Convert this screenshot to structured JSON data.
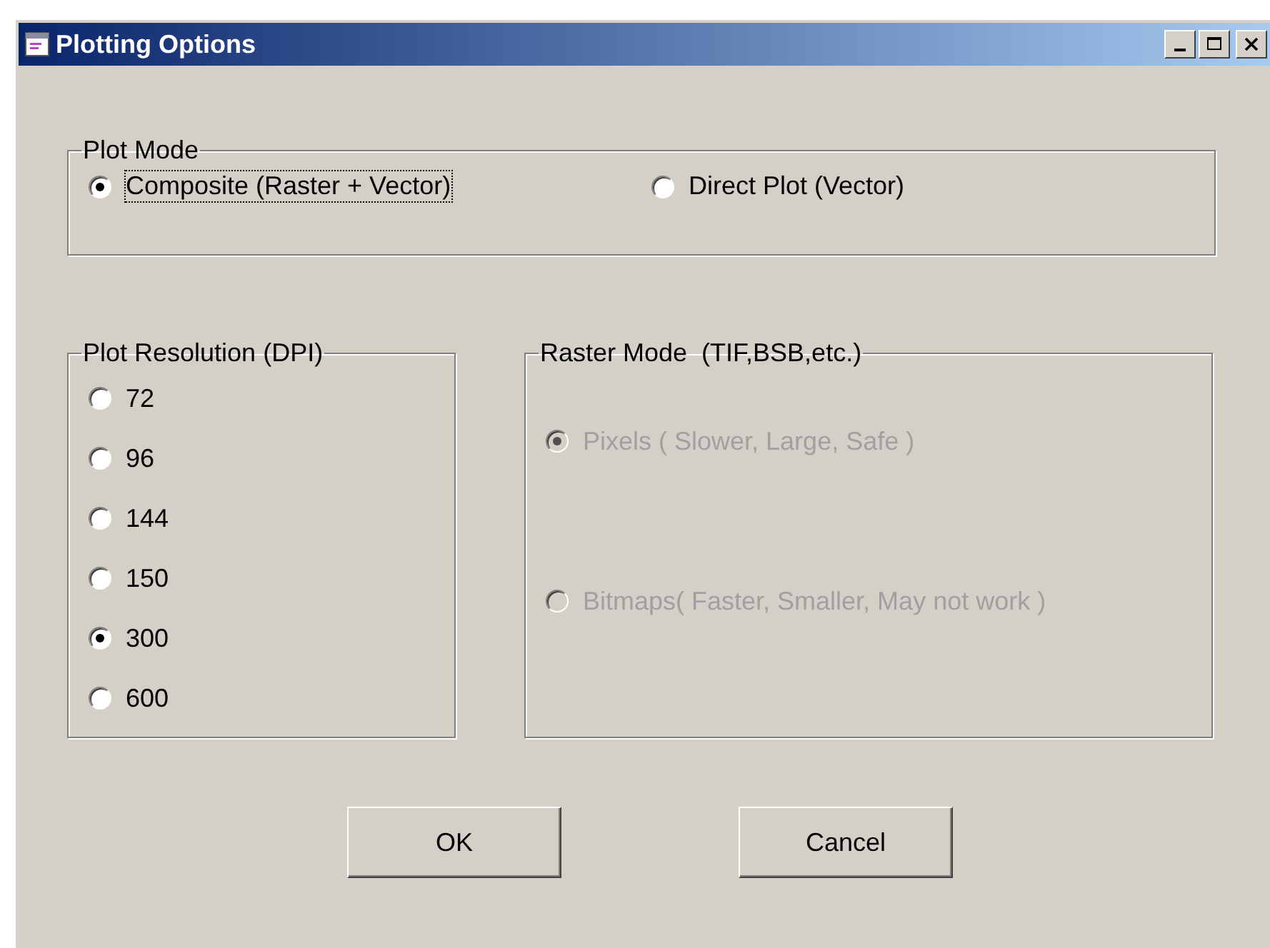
{
  "window": {
    "title": "Plotting Options"
  },
  "plot_mode": {
    "label": "Plot Mode",
    "options": [
      {
        "label": "Composite (Raster + Vector)",
        "selected": true,
        "focused": true,
        "disabled": false
      },
      {
        "label": "Direct Plot (Vector)",
        "selected": false,
        "focused": false,
        "disabled": false
      }
    ]
  },
  "plot_resolution": {
    "label": "Plot Resolution (DPI)",
    "options": [
      {
        "label": "72",
        "selected": false,
        "focused": false,
        "disabled": false
      },
      {
        "label": "96",
        "selected": false,
        "focused": false,
        "disabled": false
      },
      {
        "label": "144",
        "selected": false,
        "focused": false,
        "disabled": false
      },
      {
        "label": "150",
        "selected": false,
        "focused": false,
        "disabled": false
      },
      {
        "label": "300",
        "selected": true,
        "focused": false,
        "disabled": false
      },
      {
        "label": "600",
        "selected": false,
        "focused": false,
        "disabled": false
      }
    ]
  },
  "raster_mode": {
    "label": "Raster Mode  (TIF,BSB,etc.)",
    "options": [
      {
        "label": "Pixels ( Slower, Large, Safe )",
        "selected": true,
        "focused": false,
        "disabled": true
      },
      {
        "label": "Bitmaps( Faster, Smaller, May not work )",
        "selected": false,
        "focused": false,
        "disabled": true
      }
    ]
  },
  "buttons": [
    "OK",
    "Cancel"
  ]
}
